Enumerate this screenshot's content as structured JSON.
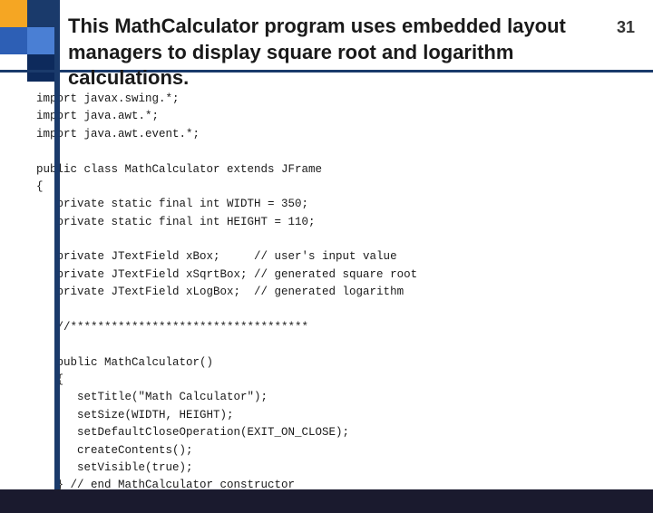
{
  "slide": {
    "number": "31",
    "title_line1": "This MathCalculator program uses embedded layout",
    "title_line2": "managers to display square root and logarithm calculations.",
    "code": [
      "import javax.swing.*;",
      "import java.awt.*;",
      "import java.awt.event.*;",
      "",
      "public class MathCalculator extends JFrame",
      "{",
      "   private static final int WIDTH = 350;",
      "   private static final int HEIGHT = 110;",
      "",
      "   private JTextField xBox;     // user's input value",
      "   private JTextField xSqrtBox; // generated square root",
      "   private JTextField xLogBox;  // generated logarithm",
      "",
      "   //***********************************",
      "",
      "   public MathCalculator()",
      "   {",
      "      setTitle(\"Math Calculator\");",
      "      setSize(WIDTH, HEIGHT);",
      "      setDefaultCloseOperation(EXIT_ON_CLOSE);",
      "      createContents();",
      "      setVisible(true);",
      "   } // end MathCalculator constructor"
    ],
    "squares": [
      {
        "color": "#f5a623"
      },
      {
        "color": "#1a3a6b"
      },
      {
        "color": "#2d5fb5"
      },
      {
        "color": "#4a7fd4"
      },
      {
        "color": "#ffffff"
      },
      {
        "color": "#0d2a5c"
      }
    ]
  }
}
